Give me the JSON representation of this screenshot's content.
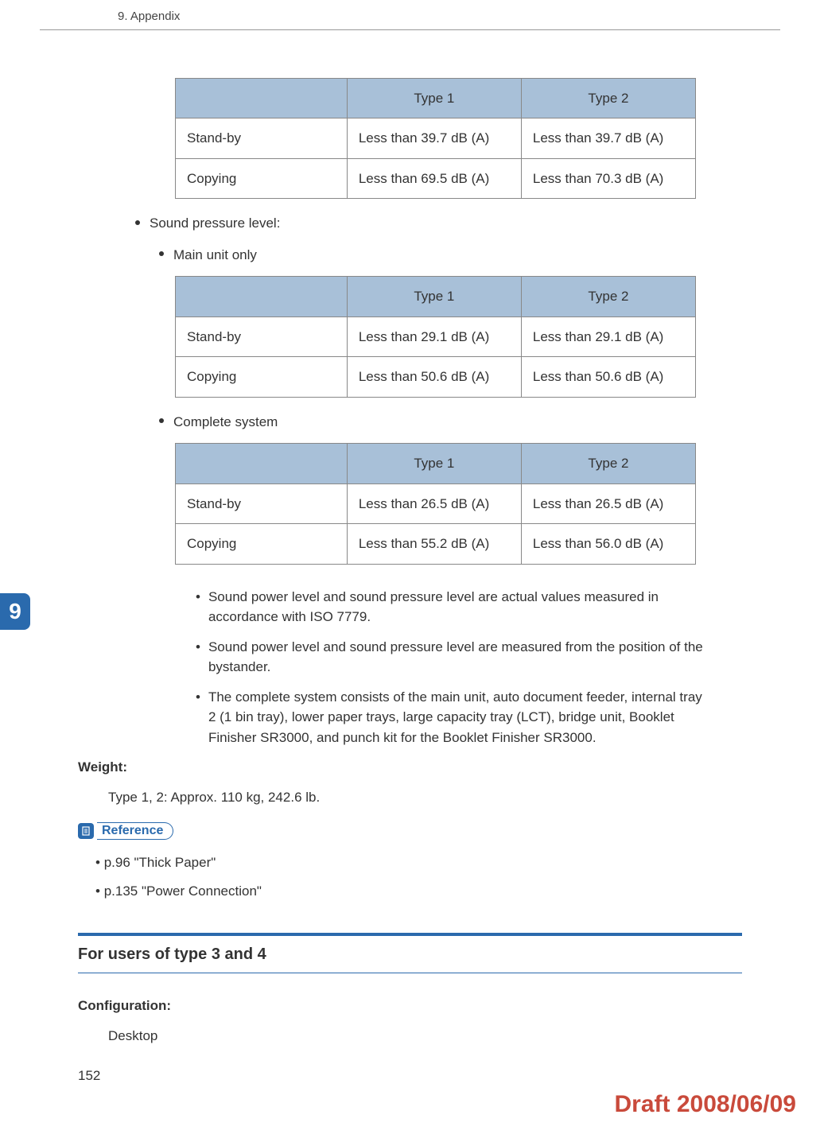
{
  "header": "9. Appendix",
  "side_tab": "9",
  "chart_data": [
    {
      "type": "table",
      "title": "",
      "columns": [
        "",
        "Type 1",
        "Type 2"
      ],
      "rows": [
        [
          "Stand-by",
          "Less than 39.7 dB (A)",
          "Less than 39.7 dB (A)"
        ],
        [
          "Copying",
          "Less than 69.5 dB (A)",
          "Less than 70.3 dB (A)"
        ]
      ]
    },
    {
      "type": "table",
      "title": "Main unit only",
      "columns": [
        "",
        "Type 1",
        "Type 2"
      ],
      "rows": [
        [
          "Stand-by",
          "Less than 29.1 dB (A)",
          "Less than 29.1 dB (A)"
        ],
        [
          "Copying",
          "Less than 50.6 dB (A)",
          "Less than 50.6 dB (A)"
        ]
      ]
    },
    {
      "type": "table",
      "title": "Complete system",
      "columns": [
        "",
        "Type 1",
        "Type 2"
      ],
      "rows": [
        [
          "Stand-by",
          "Less than 26.5 dB (A)",
          "Less than 26.5 dB (A)"
        ],
        [
          "Copying",
          "Less than 55.2 dB (A)",
          "Less than 56.0 dB (A)"
        ]
      ]
    }
  ],
  "bullets": {
    "sound_pressure": "Sound pressure level:",
    "main_unit": "Main unit only",
    "complete_system": "Complete system",
    "notes": [
      "Sound power level and sound pressure level are actual values measured in accordance with ISO 7779.",
      "Sound power level and sound pressure level are measured from the position of the bystander.",
      "The complete system consists of the main unit, auto document feeder, internal tray 2 (1 bin tray), lower paper trays, large capacity tray (LCT), bridge unit, Booklet Finisher SR3000, and punch kit for the Booklet Finisher SR3000."
    ]
  },
  "weight": {
    "label": "Weight:",
    "value": "Type 1, 2: Approx. 110 kg, 242.6 lb."
  },
  "reference": {
    "label": "Reference",
    "items": [
      "p.96 \"Thick Paper\"",
      "p.135 \"Power Connection\""
    ]
  },
  "section": {
    "title": "For users of type 3 and 4",
    "config_label": "Configuration:",
    "config_value": "Desktop"
  },
  "page_number": "152",
  "draft": "Draft 2008/06/09"
}
